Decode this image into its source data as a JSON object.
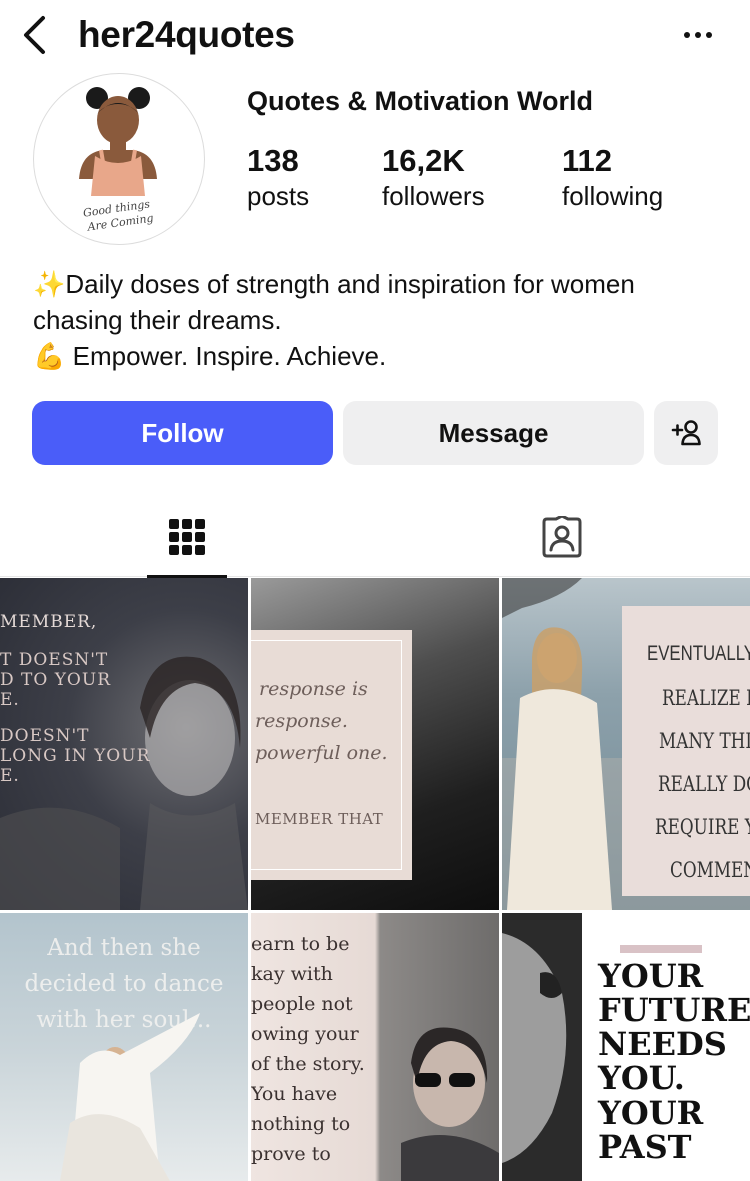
{
  "header": {
    "username": "her24quotes",
    "back_icon": "chevron-left-icon",
    "more_icon": "more-horizontal-icon"
  },
  "profile": {
    "display_name": "Quotes & Motivation World",
    "avatar_caption_line1": "Good things",
    "avatar_caption_line2": "Are Coming",
    "stats": [
      {
        "value": "138",
        "label": "posts"
      },
      {
        "value": "16,2K",
        "label": "followers"
      },
      {
        "value": "112",
        "label": "following"
      }
    ],
    "bio": {
      "line1_emoji": "✨",
      "line1": "Daily doses of strength and inspiration for women",
      "line2": "chasing their dreams.",
      "line3_emoji": "💪",
      "line3": "Empower. Inspire. Achieve."
    }
  },
  "actions": {
    "follow_label": "Follow",
    "message_label": "Message",
    "add_user_icon": "add-person-icon",
    "follow_color": "#4a5df9"
  },
  "tabs": [
    {
      "name": "grid",
      "icon": "grid-icon",
      "active": true
    },
    {
      "name": "tagged",
      "icon": "tagged-person-icon",
      "active": false
    }
  ],
  "posts": {
    "p1": [
      "MEMBER,",
      "T DOESN'T",
      "D TO YOUR",
      "E.",
      "DOESN'T",
      "LONG IN YOUR",
      "E."
    ],
    "p2": [
      "response is",
      "response.",
      "powerful one.",
      "MEMBER THAT"
    ],
    "p3": [
      "EVENTUALLY",
      "REALIZE HO",
      "MANY THIN",
      "REALLY DO",
      "REQUIRE YO",
      "COMMENT"
    ],
    "p4": [
      "And then she",
      "decided to dance",
      "with her soul..."
    ],
    "p5": [
      "earn to be",
      "kay with",
      "people not",
      "owing your",
      "of the story.",
      "You have",
      "nothing to",
      "prove to"
    ],
    "p6": [
      "YOUR",
      "FUTURE",
      "NEEDS",
      "YOU.",
      "YOUR",
      "PAST"
    ]
  }
}
